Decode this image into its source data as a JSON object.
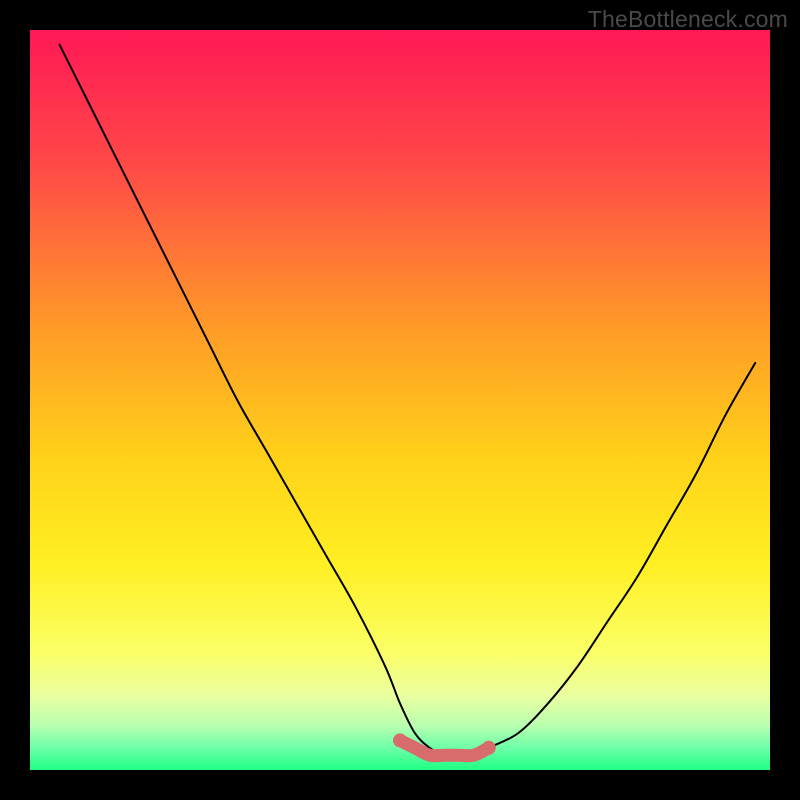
{
  "watermark": "TheBottleneck.com",
  "chart_data": {
    "type": "line",
    "title": "",
    "xlabel": "",
    "ylabel": "",
    "xlim": [
      0,
      100
    ],
    "ylim": [
      0,
      100
    ],
    "grid": false,
    "series": [
      {
        "name": "bottleneck-curve",
        "x": [
          4,
          8,
          12,
          16,
          20,
          24,
          28,
          32,
          36,
          40,
          44,
          48,
          50,
          52,
          54,
          56,
          58,
          60,
          62,
          66,
          70,
          74,
          78,
          82,
          86,
          90,
          94,
          98
        ],
        "values": [
          98,
          90,
          82,
          74,
          66,
          58,
          50,
          43,
          36,
          29,
          22,
          14,
          9,
          5,
          3,
          2,
          2,
          2,
          3,
          5,
          9,
          14,
          20,
          26,
          33,
          40,
          48,
          55
        ]
      }
    ],
    "highlight": {
      "name": "optimal-range",
      "x": [
        50,
        52,
        54,
        56,
        58,
        60,
        62
      ],
      "values": [
        4,
        3,
        2,
        2,
        2,
        2,
        3
      ]
    },
    "gradient_bg": {
      "stops": [
        {
          "offset": 0.0,
          "color": "#ff1856"
        },
        {
          "offset": 0.18,
          "color": "#ff4848"
        },
        {
          "offset": 0.4,
          "color": "#ff9a28"
        },
        {
          "offset": 0.58,
          "color": "#ffd219"
        },
        {
          "offset": 0.72,
          "color": "#ffef22"
        },
        {
          "offset": 0.84,
          "color": "#fbff66"
        },
        {
          "offset": 0.9,
          "color": "#eaffa0"
        },
        {
          "offset": 0.94,
          "color": "#b8ffb0"
        },
        {
          "offset": 0.97,
          "color": "#6effa8"
        },
        {
          "offset": 1.0,
          "color": "#1eff84"
        }
      ]
    }
  }
}
